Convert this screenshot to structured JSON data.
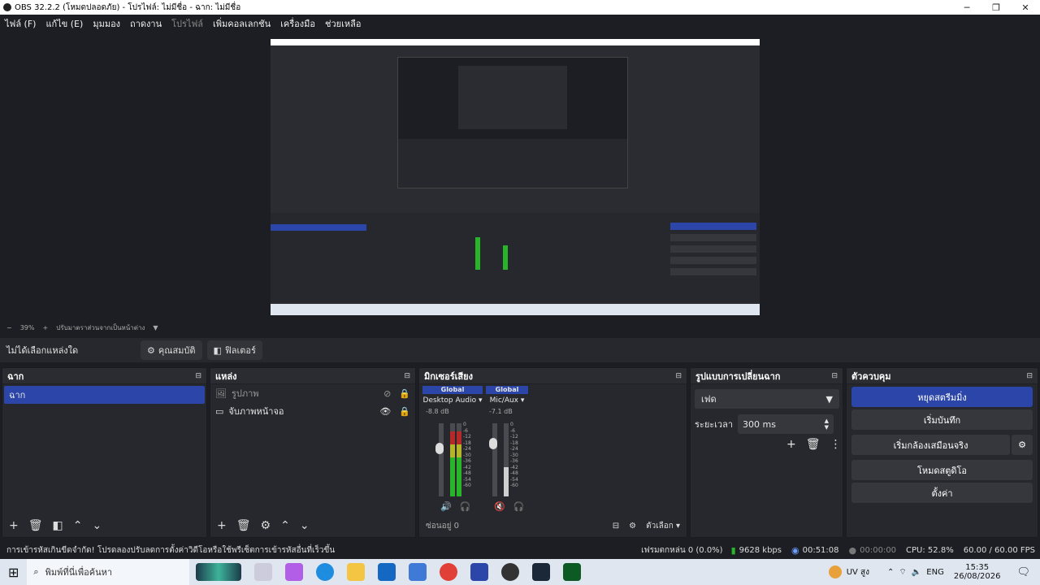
{
  "window": {
    "title": "OBS 32.2.2 (โหมดปลอดภัย) - โปรไฟล์: ไม่มีชื่อ - ฉาก: ไม่มีชื่อ",
    "min": "─",
    "max": "❐",
    "close": "✕"
  },
  "menu": [
    "ไฟล์ (F)",
    "แก้ไข (E)",
    "มุมมอง",
    "ถาดงาน",
    "โปรไฟล์",
    "เพิ่มคอลเลกชัน",
    "เครื่องมือ",
    "ช่วยเหลือ"
  ],
  "preview_bar": {
    "zoom": "39%",
    "fit_label": "ปรับมาตราส่วนจากเป็นหน้าต่าง",
    "minus": "−",
    "plus": "+",
    "caret": "▼"
  },
  "source_bar": {
    "no_selection": "ไม่ได้เลือกแหล่งใด",
    "properties": "คุณสมบัติ",
    "filters": "ฟิลเตอร์"
  },
  "scenes": {
    "title": "ฉาก",
    "items": [
      "ฉาก"
    ]
  },
  "sources": {
    "title": "แหล่ง",
    "items": [
      {
        "label": "รูปภาพ",
        "visible": false
      },
      {
        "label": "จับภาพหน้าจอ",
        "visible": true
      }
    ]
  },
  "mixer": {
    "title": "มิกเซอร์เสียง",
    "channels": [
      {
        "tag": "Global",
        "name": "Desktop Audio",
        "db": "-8.8 dB",
        "level": 0.78,
        "muted": false
      },
      {
        "tag": "Global",
        "name": "Mic/Aux",
        "db": "-7.1 dB",
        "level": 0.35,
        "muted": true
      }
    ],
    "scale": [
      "0",
      "-6",
      "-12",
      "-18",
      "-24",
      "-30",
      "-36",
      "-42",
      "-48",
      "-54",
      "-60"
    ],
    "hidden_label": "ซ่อนอยู่ 0",
    "options_label": "ตัวเลือก"
  },
  "transitions": {
    "title": "รูปแบบการเปลี่ยนฉาก",
    "selected": "เฟด",
    "duration_label": "ระยะเวลา",
    "duration_value": "300 ms"
  },
  "controls": {
    "title": "ตัวควบคุม",
    "stop_stream": "หยุดสตรีมมิ่ง",
    "start_record": "เริ่มบันทึก",
    "virtual_cam": "เริ่มกล้องเสมือนจริง",
    "studio_mode": "โหมดสตูดิโอ",
    "settings": "ตั้งค่า"
  },
  "status": {
    "warning": "การเข้ารหัสเกินขีดจำกัด! โปรดลองปรับลดการตั้งค่าวิดีโอหรือใช้พรีเซ็ตการเข้ารหัสอื่นที่เร็วขึ้น",
    "dropped": "เฟรมตกหล่น 0 (0.0%)",
    "bitrate": "9628 kbps",
    "stream_time": "00:51:08",
    "record_time": "00:00:00",
    "cpu": "CPU: 52.8%",
    "fps": "60.00 / 60.00 FPS"
  },
  "taskbar": {
    "search_placeholder": "พิมพ์ที่นี่เพื่อค้นหา",
    "weather": "UV สูง",
    "lang": "ENG",
    "time": "15:35",
    "date": "26/08/2026"
  }
}
